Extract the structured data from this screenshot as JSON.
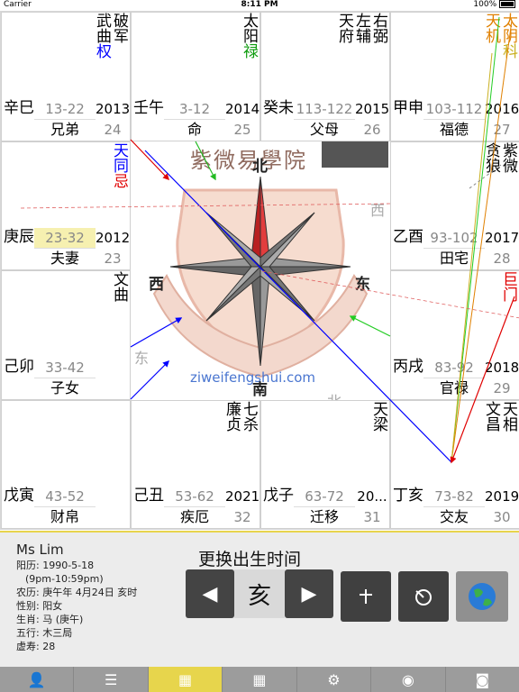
{
  "status_bar": {
    "carrier": "Carrier",
    "time": "8:11 PM",
    "battery": "100%"
  },
  "chart": {
    "watermark_title": "紫微易學院",
    "watermark_url": "ziweifengshui.com",
    "compass": {
      "north": "北",
      "east": "东",
      "west": "西",
      "south": "南"
    },
    "faded_dirs": {
      "west": "西",
      "east": "东",
      "north": "北"
    },
    "palaces": [
      {
        "stars": [
          {
            "t": "破军",
            "c": "#000"
          },
          {
            "t": "武曲权",
            "c": "#000",
            "hl": "权",
            "hlc": "#0000ff"
          }
        ],
        "ganzhi": "辛巳",
        "age": "13-22",
        "name": "兄弟",
        "year": "2013",
        "xusui": "24"
      },
      {
        "stars": [
          {
            "t": "太阳禄",
            "c": "#000",
            "hl": "禄",
            "hlc": "#0a9a0a"
          }
        ],
        "ganzhi": "壬午",
        "age": "3-12",
        "name": "命",
        "year": "2014",
        "xusui": "25"
      },
      {
        "stars": [
          {
            "t": "右弼",
            "c": "#000"
          },
          {
            "t": "左辅",
            "c": "#000"
          },
          {
            "t": "天府",
            "c": "#000"
          }
        ],
        "ganzhi": "癸未",
        "age": "113-122",
        "name": "父母",
        "year": "2015",
        "xusui": "26"
      },
      {
        "stars": [
          {
            "t": "太阴科",
            "c": "#e08000",
            "hl": "科",
            "hlc": "#c9b020"
          },
          {
            "t": "天机",
            "c": "#e08000"
          }
        ],
        "ganzhi": "甲申",
        "age": "103-112",
        "name": "福德",
        "year": "2016",
        "xusui": "27"
      },
      {
        "stars": [
          {
            "t": "天同忌",
            "c": "#0000ff",
            "hl": "忌",
            "hlc": "#e00000"
          }
        ],
        "ganzhi": "庚辰",
        "age": "23-32",
        "name": "夫妻",
        "year": "2012",
        "xusui": "23",
        "age_hl": true
      },
      {
        "stars": [
          {
            "t": "紫微",
            "c": "#000"
          },
          {
            "t": "贪狼",
            "c": "#000"
          }
        ],
        "ganzhi": "乙酉",
        "age": "93-102",
        "name": "田宅",
        "year": "2017",
        "xusui": "28"
      },
      {
        "stars": [
          {
            "t": "文曲",
            "c": "#000"
          }
        ],
        "ganzhi": "己卯",
        "age": "33-42",
        "name": "子女",
        "year": "",
        "xusui": ""
      },
      {
        "stars": [
          {
            "t": "巨门",
            "c": "#e00000"
          }
        ],
        "ganzhi": "丙戌",
        "age": "83-92",
        "name": "官禄",
        "year": "2018",
        "xusui": "29"
      },
      {
        "stars": [],
        "ganzhi": "戊寅",
        "age": "43-52",
        "name": "财帛",
        "year": "",
        "xusui": ""
      },
      {
        "stars": [
          {
            "t": "七杀",
            "c": "#000"
          },
          {
            "t": "廉贞",
            "c": "#000"
          }
        ],
        "ganzhi": "己丑",
        "age": "53-62",
        "name": "疾厄",
        "year": "2021",
        "xusui": "32"
      },
      {
        "stars": [
          {
            "t": "天梁",
            "c": "#000"
          }
        ],
        "ganzhi": "戊子",
        "age": "63-72",
        "name": "迁移",
        "year": "20...",
        "xusui": "31"
      },
      {
        "stars": [
          {
            "t": "天相",
            "c": "#000"
          },
          {
            "t": "文昌",
            "c": "#000"
          }
        ],
        "ganzhi": "丁亥",
        "age": "73-82",
        "name": "交友",
        "year": "2019",
        "xusui": "30"
      }
    ]
  },
  "profile": {
    "name": "Ms Lim",
    "solar": "阳历: 1990-5-18",
    "time_range": "(9pm-10:59pm)",
    "lunar": "农历: 庚午年 4月24日 亥时",
    "gender": "性别: 阳女",
    "zodiac": "生肖: 马 (庚午)",
    "element": "五行: 木三局",
    "age": "虚寿: 28"
  },
  "controls": {
    "title": "更换出生时间",
    "prev": "◀",
    "current_hour": "亥",
    "next": "▶"
  },
  "tabs": [
    "add-user",
    "list",
    "chart",
    "edit",
    "settings",
    "view",
    "camera"
  ]
}
